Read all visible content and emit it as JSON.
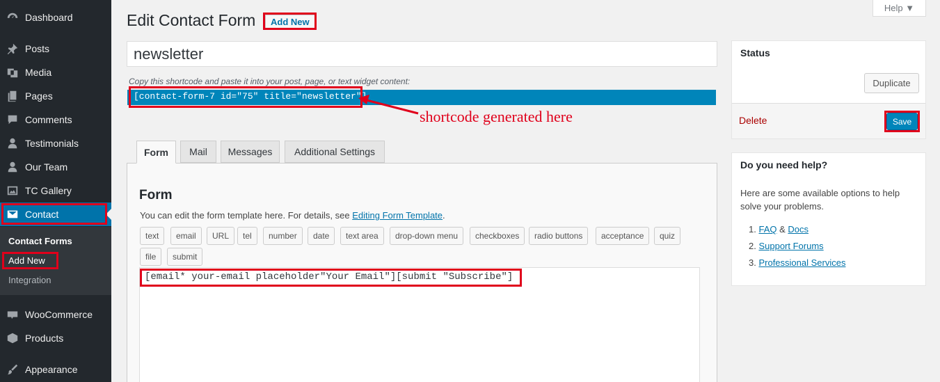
{
  "sidebar": {
    "items": [
      {
        "label": "Dashboard",
        "icon": "dashboard-icon"
      },
      {
        "label": "Posts",
        "icon": "pin-icon"
      },
      {
        "label": "Media",
        "icon": "media-icon"
      },
      {
        "label": "Pages",
        "icon": "pages-icon"
      },
      {
        "label": "Comments",
        "icon": "comments-icon"
      },
      {
        "label": "Testimonials",
        "icon": "user-icon"
      },
      {
        "label": "Our Team",
        "icon": "user-icon"
      },
      {
        "label": "TC Gallery",
        "icon": "gallery-icon"
      },
      {
        "label": "Contact",
        "icon": "mail-icon"
      },
      {
        "label": "WooCommerce",
        "icon": "woocommerce-icon"
      },
      {
        "label": "Products",
        "icon": "products-icon"
      },
      {
        "label": "Appearance",
        "icon": "brush-icon"
      }
    ],
    "submenu": {
      "contact_forms": "Contact Forms",
      "add_new": "Add New",
      "integration": "Integration"
    }
  },
  "header": {
    "title": "Edit Contact Form",
    "add_new": "Add New",
    "help": "Help ▼"
  },
  "form": {
    "title_value": "newsletter",
    "shortcode_hint": "Copy this shortcode and paste it into your post, page, or text widget content:",
    "shortcode": "[contact-form-7 id=\"75\" title=\"newsletter\"]",
    "annotation": "shortcode generated here",
    "tabs": [
      "Form",
      "Mail",
      "Messages",
      "Additional Settings"
    ],
    "panel_heading": "Form",
    "panel_desc": "You can edit the form template here. For details, see ",
    "panel_link": "Editing Form Template",
    "panel_desc_end": ".",
    "tags_row1": [
      "text",
      "email",
      "URL",
      "tel",
      "number",
      "date",
      "text area",
      "drop-down menu",
      "checkboxes",
      "radio buttons",
      "acceptance",
      "quiz"
    ],
    "tags_row2": [
      "file",
      "submit"
    ],
    "template": "[email* your-email placeholder\"Your Email\"][submit \"Subscribe\"]"
  },
  "status": {
    "title": "Status",
    "duplicate": "Duplicate",
    "delete": "Delete",
    "save": "Save"
  },
  "help_box": {
    "title": "Do you need help?",
    "desc": "Here are some available options to help solve your problems.",
    "item1_num": "1.",
    "item1_a": "FAQ",
    "item1_mid": " & ",
    "item1_b": "Docs",
    "item2_num": "2.",
    "item2": "Support Forums",
    "item3_num": "3.",
    "item3": "Professional Services"
  },
  "colors": {
    "sidebar_bg": "#23282d",
    "accent": "#0073aa",
    "annotation_red": "#e0001b"
  }
}
